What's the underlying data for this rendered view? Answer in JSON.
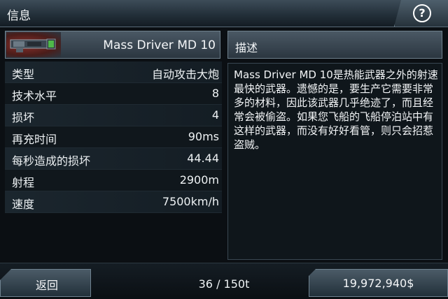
{
  "header": {
    "title": "信息",
    "help_icon": "question-mark-icon",
    "help_glyph": "?"
  },
  "item": {
    "name": "Mass Driver MD 10",
    "thumbnail": "weapon-thumbnail-icon",
    "stats": [
      {
        "label": "类型",
        "value": "自动攻击大炮"
      },
      {
        "label": "技术水平",
        "value": "8"
      },
      {
        "label": "损坏",
        "value": "4"
      },
      {
        "label": "再充时间",
        "value": "90ms"
      },
      {
        "label": "每秒造成的损坏",
        "value": "44.44"
      },
      {
        "label": "射程",
        "value": "2900m"
      },
      {
        "label": "速度",
        "value": "7500km/h"
      }
    ]
  },
  "description": {
    "title": "描述",
    "text": "Mass Driver MD 10是热能武器之外的射速最快的武器。遗憾的是，要生产它需要非常多的材料，因此该武器几乎绝迹了，而且经常会被偷盗。如果您飞船的飞船停泊站中有这样的武器，而没有好好看管，则只会招惹盗贼。"
  },
  "footer": {
    "back_label": "返回",
    "cargo": "36 / 150t",
    "credits": "19,972,940$"
  }
}
